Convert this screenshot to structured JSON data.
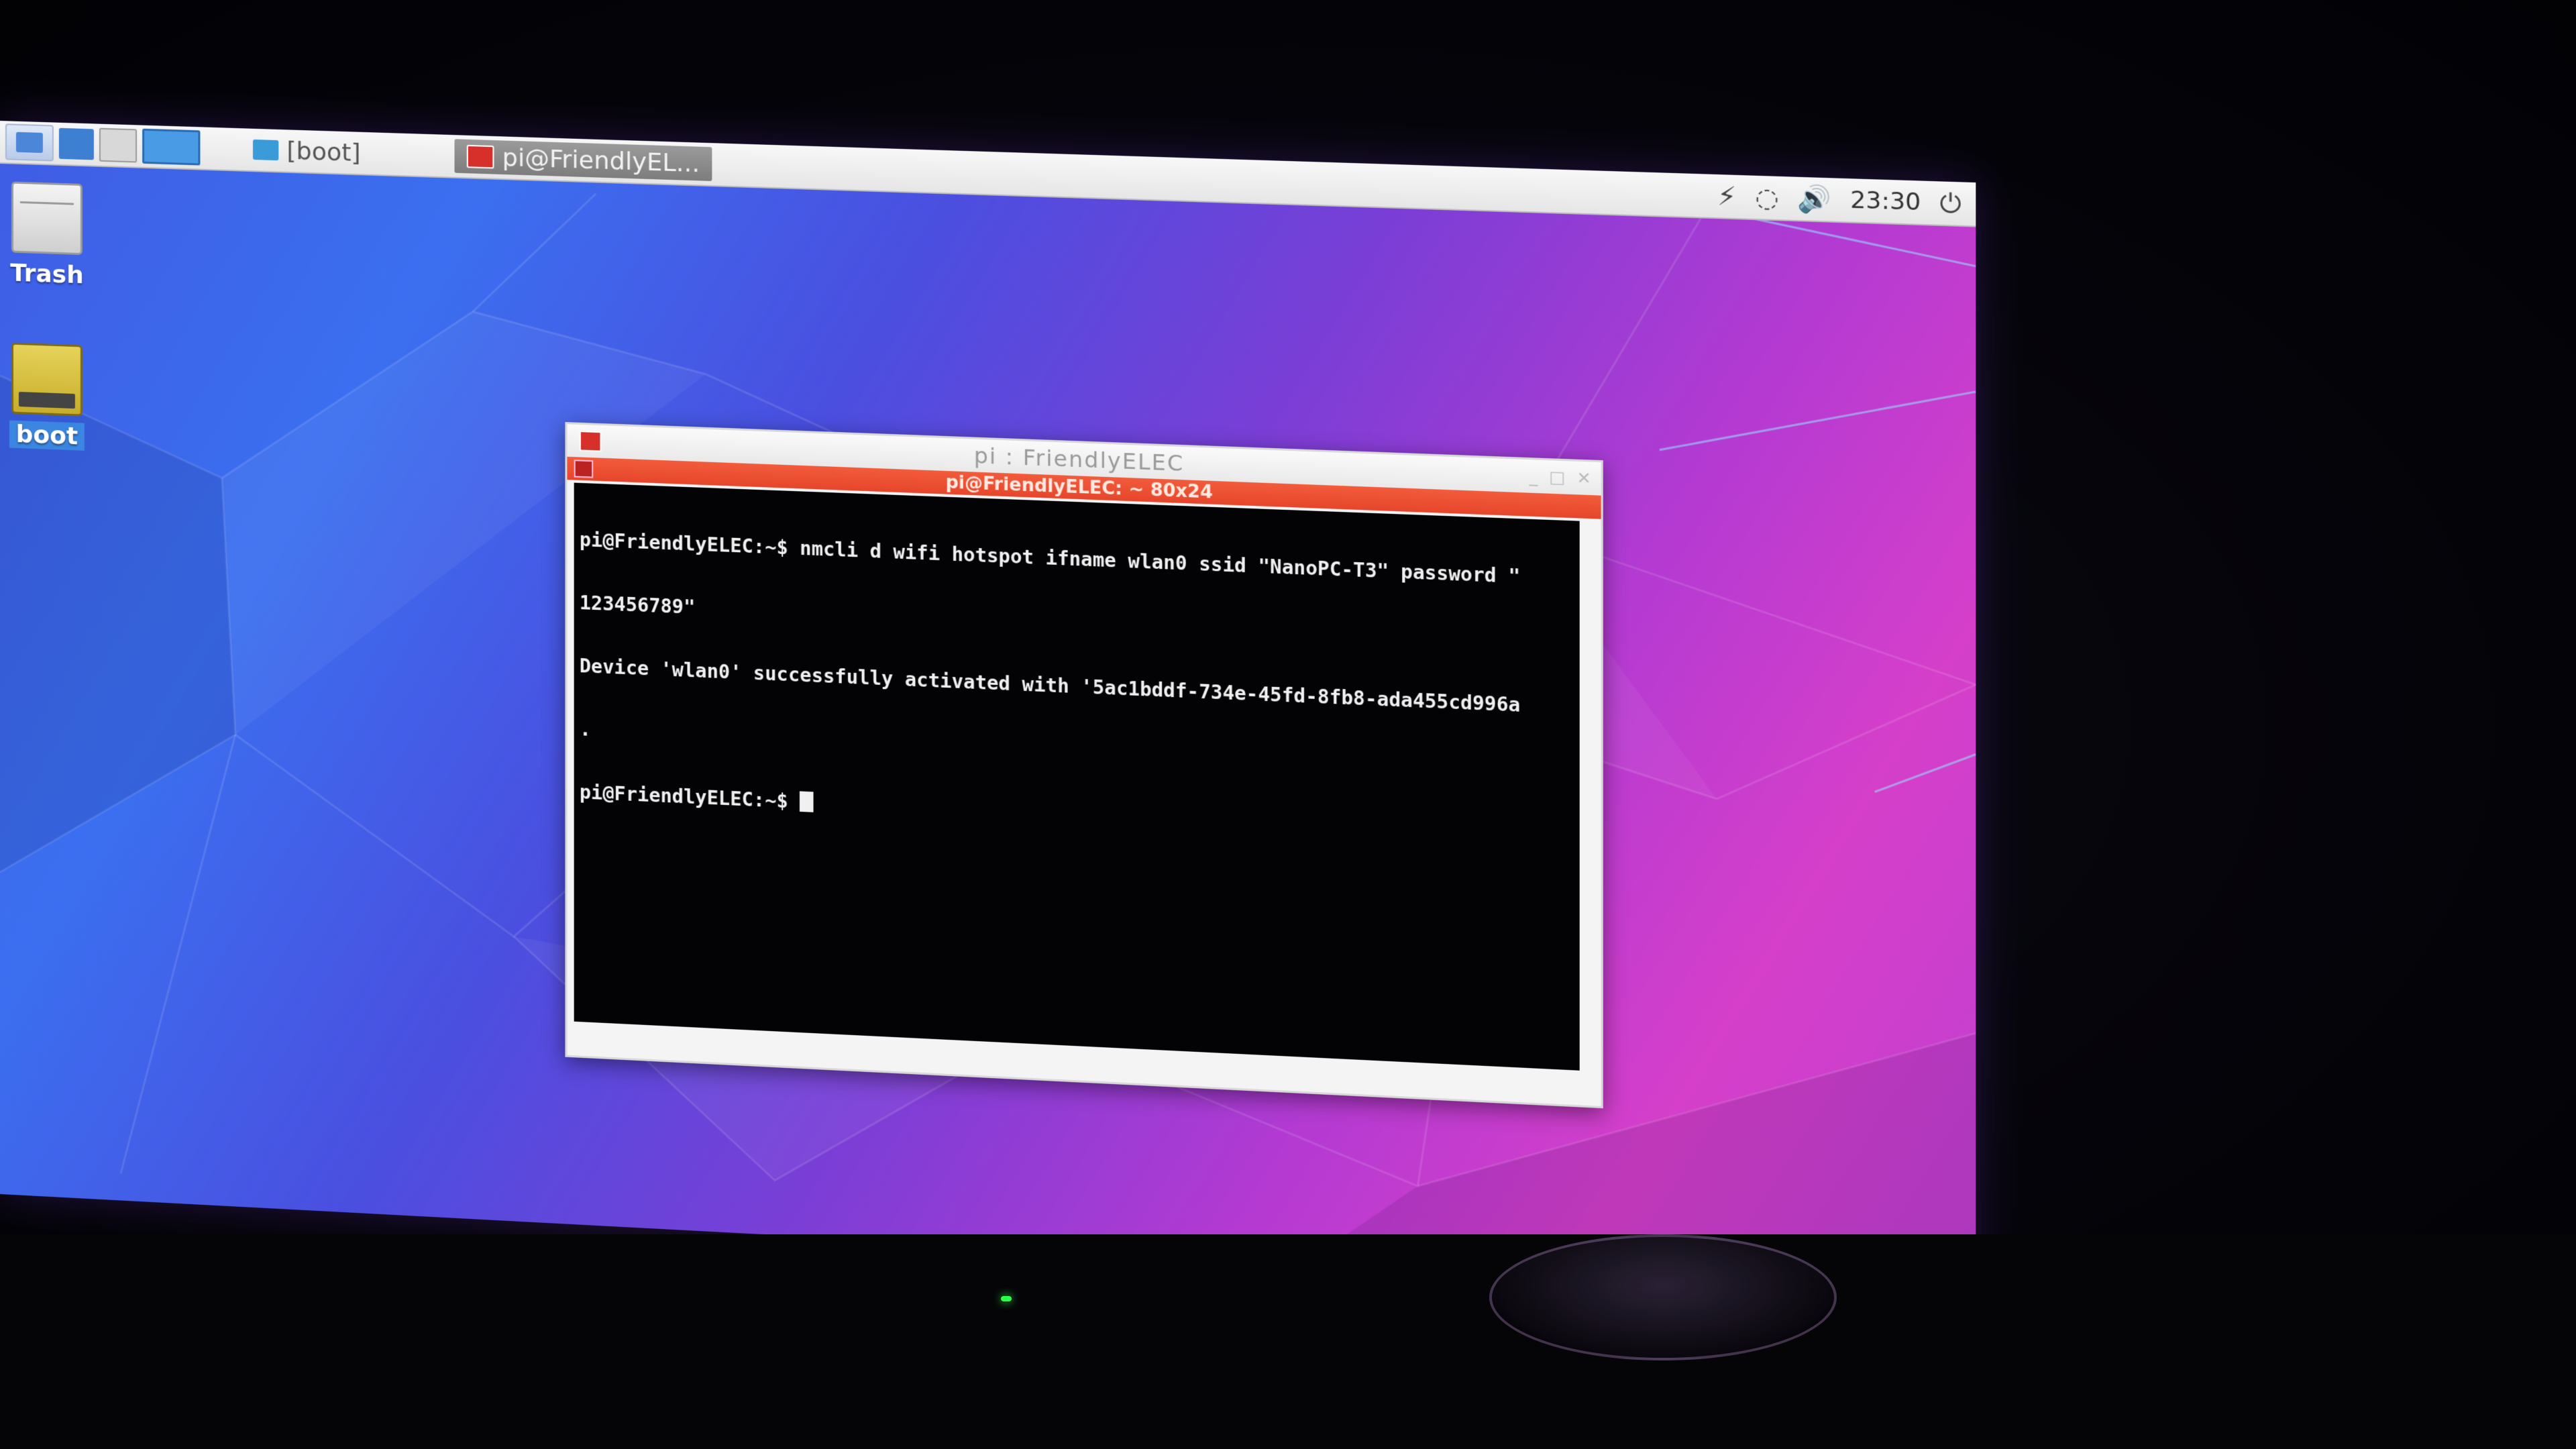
{
  "taskbar": {
    "tasks": [
      {
        "label": "[boot]"
      },
      {
        "label": "pi@FriendlyEL..."
      }
    ],
    "clock": "23:30",
    "icons": {
      "launcher": "menu-launcher-icon",
      "network": "network-icon",
      "volume": "volume-icon",
      "power": "power-icon",
      "bolt": "bolt-icon"
    }
  },
  "desktop": {
    "icons": [
      {
        "label": "Trash"
      },
      {
        "label": "boot"
      }
    ]
  },
  "terminal": {
    "window_title": "pi : FriendlyELEC",
    "tab_title": "pi@FriendlyELEC: ~ 80x24",
    "lines": [
      "pi@FriendlyELEC:~$ nmcli d wifi hotspot ifname wlan0 ssid \"NanoPC-T3\" password \"",
      "123456789\"",
      "Device 'wlan0' successfully activated with '5ac1bddf-734e-45fd-8fb8-ada455cd996a",
      ".",
      "pi@FriendlyELEC:~$ "
    ]
  },
  "colors": {
    "terminal_tab": "#e6462b",
    "terminal_bg": "#030306",
    "wallpaper_blue": "#3b6ff0",
    "wallpaper_magenta": "#d53fca"
  }
}
